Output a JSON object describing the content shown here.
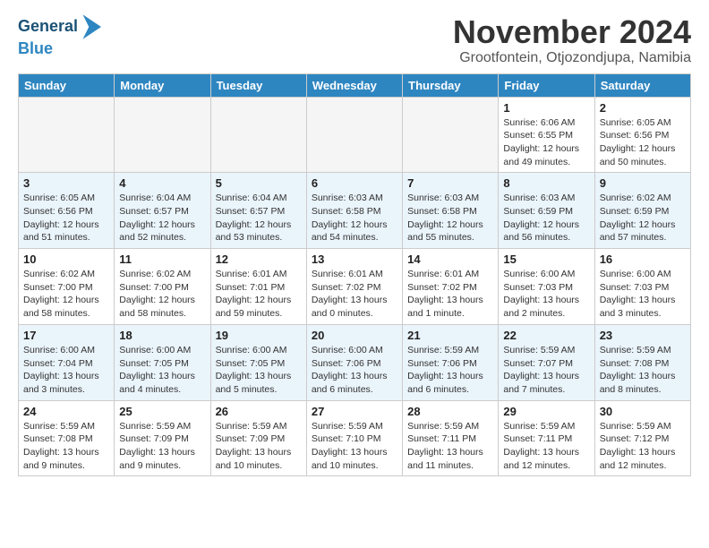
{
  "header": {
    "logo_line1": "General",
    "logo_line2": "Blue",
    "month_title": "November 2024",
    "subtitle": "Grootfontein, Otjozondjupa, Namibia"
  },
  "weekdays": [
    "Sunday",
    "Monday",
    "Tuesday",
    "Wednesday",
    "Thursday",
    "Friday",
    "Saturday"
  ],
  "weeks": [
    [
      {
        "day": "",
        "info": ""
      },
      {
        "day": "",
        "info": ""
      },
      {
        "day": "",
        "info": ""
      },
      {
        "day": "",
        "info": ""
      },
      {
        "day": "",
        "info": ""
      },
      {
        "day": "1",
        "info": "Sunrise: 6:06 AM\nSunset: 6:55 PM\nDaylight: 12 hours\nand 49 minutes."
      },
      {
        "day": "2",
        "info": "Sunrise: 6:05 AM\nSunset: 6:56 PM\nDaylight: 12 hours\nand 50 minutes."
      }
    ],
    [
      {
        "day": "3",
        "info": "Sunrise: 6:05 AM\nSunset: 6:56 PM\nDaylight: 12 hours\nand 51 minutes."
      },
      {
        "day": "4",
        "info": "Sunrise: 6:04 AM\nSunset: 6:57 PM\nDaylight: 12 hours\nand 52 minutes."
      },
      {
        "day": "5",
        "info": "Sunrise: 6:04 AM\nSunset: 6:57 PM\nDaylight: 12 hours\nand 53 minutes."
      },
      {
        "day": "6",
        "info": "Sunrise: 6:03 AM\nSunset: 6:58 PM\nDaylight: 12 hours\nand 54 minutes."
      },
      {
        "day": "7",
        "info": "Sunrise: 6:03 AM\nSunset: 6:58 PM\nDaylight: 12 hours\nand 55 minutes."
      },
      {
        "day": "8",
        "info": "Sunrise: 6:03 AM\nSunset: 6:59 PM\nDaylight: 12 hours\nand 56 minutes."
      },
      {
        "day": "9",
        "info": "Sunrise: 6:02 AM\nSunset: 6:59 PM\nDaylight: 12 hours\nand 57 minutes."
      }
    ],
    [
      {
        "day": "10",
        "info": "Sunrise: 6:02 AM\nSunset: 7:00 PM\nDaylight: 12 hours\nand 58 minutes."
      },
      {
        "day": "11",
        "info": "Sunrise: 6:02 AM\nSunset: 7:00 PM\nDaylight: 12 hours\nand 58 minutes."
      },
      {
        "day": "12",
        "info": "Sunrise: 6:01 AM\nSunset: 7:01 PM\nDaylight: 12 hours\nand 59 minutes."
      },
      {
        "day": "13",
        "info": "Sunrise: 6:01 AM\nSunset: 7:02 PM\nDaylight: 13 hours\nand 0 minutes."
      },
      {
        "day": "14",
        "info": "Sunrise: 6:01 AM\nSunset: 7:02 PM\nDaylight: 13 hours\nand 1 minute."
      },
      {
        "day": "15",
        "info": "Sunrise: 6:00 AM\nSunset: 7:03 PM\nDaylight: 13 hours\nand 2 minutes."
      },
      {
        "day": "16",
        "info": "Sunrise: 6:00 AM\nSunset: 7:03 PM\nDaylight: 13 hours\nand 3 minutes."
      }
    ],
    [
      {
        "day": "17",
        "info": "Sunrise: 6:00 AM\nSunset: 7:04 PM\nDaylight: 13 hours\nand 3 minutes."
      },
      {
        "day": "18",
        "info": "Sunrise: 6:00 AM\nSunset: 7:05 PM\nDaylight: 13 hours\nand 4 minutes."
      },
      {
        "day": "19",
        "info": "Sunrise: 6:00 AM\nSunset: 7:05 PM\nDaylight: 13 hours\nand 5 minutes."
      },
      {
        "day": "20",
        "info": "Sunrise: 6:00 AM\nSunset: 7:06 PM\nDaylight: 13 hours\nand 6 minutes."
      },
      {
        "day": "21",
        "info": "Sunrise: 5:59 AM\nSunset: 7:06 PM\nDaylight: 13 hours\nand 6 minutes."
      },
      {
        "day": "22",
        "info": "Sunrise: 5:59 AM\nSunset: 7:07 PM\nDaylight: 13 hours\nand 7 minutes."
      },
      {
        "day": "23",
        "info": "Sunrise: 5:59 AM\nSunset: 7:08 PM\nDaylight: 13 hours\nand 8 minutes."
      }
    ],
    [
      {
        "day": "24",
        "info": "Sunrise: 5:59 AM\nSunset: 7:08 PM\nDaylight: 13 hours\nand 9 minutes."
      },
      {
        "day": "25",
        "info": "Sunrise: 5:59 AM\nSunset: 7:09 PM\nDaylight: 13 hours\nand 9 minutes."
      },
      {
        "day": "26",
        "info": "Sunrise: 5:59 AM\nSunset: 7:09 PM\nDaylight: 13 hours\nand 10 minutes."
      },
      {
        "day": "27",
        "info": "Sunrise: 5:59 AM\nSunset: 7:10 PM\nDaylight: 13 hours\nand 10 minutes."
      },
      {
        "day": "28",
        "info": "Sunrise: 5:59 AM\nSunset: 7:11 PM\nDaylight: 13 hours\nand 11 minutes."
      },
      {
        "day": "29",
        "info": "Sunrise: 5:59 AM\nSunset: 7:11 PM\nDaylight: 13 hours\nand 12 minutes."
      },
      {
        "day": "30",
        "info": "Sunrise: 5:59 AM\nSunset: 7:12 PM\nDaylight: 13 hours\nand 12 minutes."
      }
    ]
  ]
}
